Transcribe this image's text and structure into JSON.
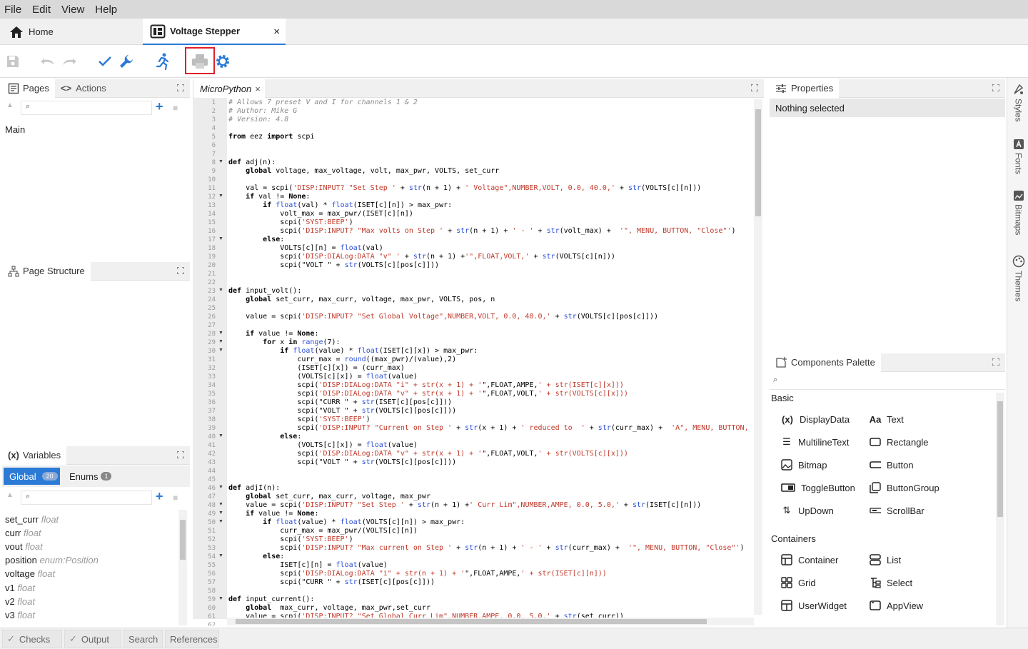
{
  "menu": [
    "File",
    "Edit",
    "View",
    "Help"
  ],
  "tabs": {
    "home": "Home",
    "project": "Voltage Stepper",
    "close": "×"
  },
  "left": {
    "pages_tab": "Pages",
    "actions_tab": "Actions",
    "pages": [
      "Main"
    ],
    "page_structure": "Page Structure",
    "variables_tab": "Variables",
    "global_label": "Global",
    "global_count": "20",
    "enums_label": "Enums",
    "enums_count": "1",
    "variables": [
      {
        "name": "set_curr",
        "type": "float"
      },
      {
        "name": "curr",
        "type": "float"
      },
      {
        "name": "vout",
        "type": "float"
      },
      {
        "name": "position",
        "type": "enum:Position"
      },
      {
        "name": "voltage",
        "type": "float"
      },
      {
        "name": "v1",
        "type": "float"
      },
      {
        "name": "v2",
        "type": "float"
      },
      {
        "name": "v3",
        "type": "float"
      }
    ]
  },
  "editor": {
    "tab": "MicroPython",
    "lines": [
      "# Allows 7 preset V and I for channels 1 & 2",
      "# Author: Mike G",
      "# Version: 4.8",
      "",
      "from eez import scpi",
      "",
      "",
      "def adj(n):",
      "    global voltage, max_voltage, volt, max_pwr, VOLTS, set_curr",
      "",
      "    val = scpi('DISP:INPUT? \"Set Step ' + str(n + 1) + ' Voltage\",NUMBER,VOLT, 0.0, 40.0,' + str(VOLTS[c][n]))",
      "    if val != None:",
      "        if float(val) * float(ISET[c][n]) > max_pwr:",
      "            volt_max = max_pwr/(ISET[c][n])",
      "            scpi('SYST:BEEP')",
      "            scpi('DISP:INPUT? \"Max volts on Step ' + str(n + 1) + ' - ' + str(volt_max) +  '\", MENU, BUTTON, \"Close\"')",
      "        else:",
      "            VOLTS[c][n] = float(val)",
      "            scpi('DISP:DIALog:DATA \"v\" ' + str(n + 1) +'\",FLOAT,VOLT,' + str(VOLTS[c][n]))",
      "            scpi(\"VOLT \" + str(VOLTS[c][pos[c]]))",
      "",
      "",
      "def input_volt():",
      "    global set_curr, max_curr, voltage, max_pwr, VOLTS, pos, n",
      "",
      "    value = scpi('DISP:INPUT? \"Set Global Voltage\",NUMBER,VOLT, 0.0, 40.0,' + str(VOLTS[c][pos[c]]))",
      "",
      "    if value != None:",
      "        for x in range(7):",
      "            if float(value) * float(ISET[c][x]) > max_pwr:",
      "                curr_max = round((max_pwr)/(value),2)",
      "                (ISET[c][x]) = (curr_max)",
      "                (VOLTS[c][x]) = float(value)",
      "                scpi('DISP:DIALog:DATA \"i\" + str(x + 1) + '\",FLOAT,AMPE,' + str(ISET[c][x]))",
      "                scpi('DISP:DIALog:DATA \"v\" + str(x + 1) + '\",FLOAT,VOLT,' + str(VOLTS[c][x]))",
      "                scpi(\"CURR \" + str(ISET[c][pos[c]]))",
      "                scpi(\"VOLT \" + str(VOLTS[c][pos[c]]))",
      "                scpi('SYST:BEEP')",
      "                scpi('DISP:INPUT? \"Current on Step ' + str(x + 1) + ' reduced to  ' + str(curr_max) +  'A\", MENU, BUTTON, '",
      "            else:",
      "                (VOLTS[c][x]) = float(value)",
      "                scpi('DISP:DIALog:DATA \"v\" + str(x + 1) + '\",FLOAT,VOLT,' + str(VOLTS[c][x]))",
      "                scpi(\"VOLT \" + str(VOLTS[c][pos[c]]))",
      "",
      "",
      "def adjI(n):",
      "    global set_curr, max_curr, voltage, max_pwr",
      "    value = scpi('DISP:INPUT? \"Set Step ' + str(n + 1) +' Curr Lim\",NUMBER,AMPE, 0.0, 5.0,' + str(ISET[c][n]))",
      "    if value != None:",
      "        if float(value) * float(VOLTS[c][n]) > max_pwr:",
      "            curr_max = max_pwr/(VOLTS[c][n])",
      "            scpi('SYST:BEEP')",
      "            scpi('DISP:INPUT? \"Max current on Step ' + str(n + 1) + ' - ' + str(curr_max) +  '\", MENU, BUTTON, \"Close\"')",
      "        else:",
      "            ISET[c][n] = float(value)",
      "            scpi('DISP:DIALog:DATA \"i\" + str(n + 1) + '\",FLOAT,AMPE,' + str(ISET[c][n]))",
      "            scpi(\"CURR \" + str(ISET[c][pos[c]]))",
      "",
      "def input_current():",
      "    global  max_curr, voltage, max_pwr,set_curr",
      "    value = scpi('DISP:INPUT? \"Set Global Curr Lim\",NUMBER,AMPE, 0.0, 5.0,' + str(set_curr))",
      ""
    ],
    "fold_lines": [
      8,
      12,
      17,
      23,
      28,
      29,
      30,
      40,
      46,
      48,
      49,
      50,
      54,
      59
    ]
  },
  "properties": {
    "tab": "Properties",
    "status": "Nothing selected"
  },
  "palette": {
    "tab": "Components Palette",
    "sections": [
      {
        "title": "Basic",
        "items": [
          "DisplayData",
          "Text",
          "MultilineText",
          "Rectangle",
          "Bitmap",
          "Button",
          "ToggleButton",
          "ButtonGroup",
          "UpDown",
          "ScrollBar"
        ]
      },
      {
        "title": "Containers",
        "items": [
          "Container",
          "List",
          "Grid",
          "Select",
          "UserWidget",
          "AppView"
        ]
      }
    ]
  },
  "side_tabs": [
    "Styles",
    "Fonts",
    "Bitmaps",
    "Themes"
  ],
  "bottom_tabs": [
    "Checks",
    "Output",
    "Search",
    "References"
  ],
  "colors": {
    "accent": "#2b7bd6",
    "highlight": "#e0202a"
  }
}
